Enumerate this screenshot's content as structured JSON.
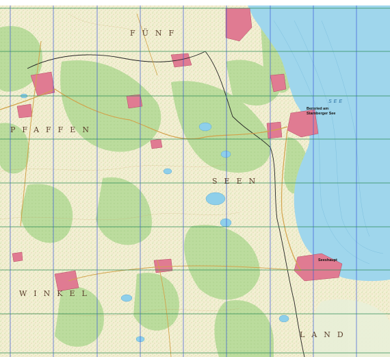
{
  "map": {
    "regions": {
      "fuenf": "FÜNF",
      "pfaffen": "PFAFFEN",
      "winkel": "WINKEL",
      "seen": "SEEN",
      "land": "LAND"
    },
    "water": {
      "lake_label": "SEE"
    },
    "places": {
      "bernried": "Bernried am",
      "bernried2": "Starnberger See",
      "seeshaupt": "Seeshaupt"
    },
    "colors": {
      "forest": "#b8d99a",
      "open_land": "#f4f1d8",
      "lake": "#9fd6ec",
      "lake_deep": "#86c8e4",
      "settlement": "#e07b92",
      "grid_blue": "#3b5bd9",
      "grid_green": "#2e8b57",
      "road": "#222222",
      "contour": "#c79a5a"
    }
  }
}
